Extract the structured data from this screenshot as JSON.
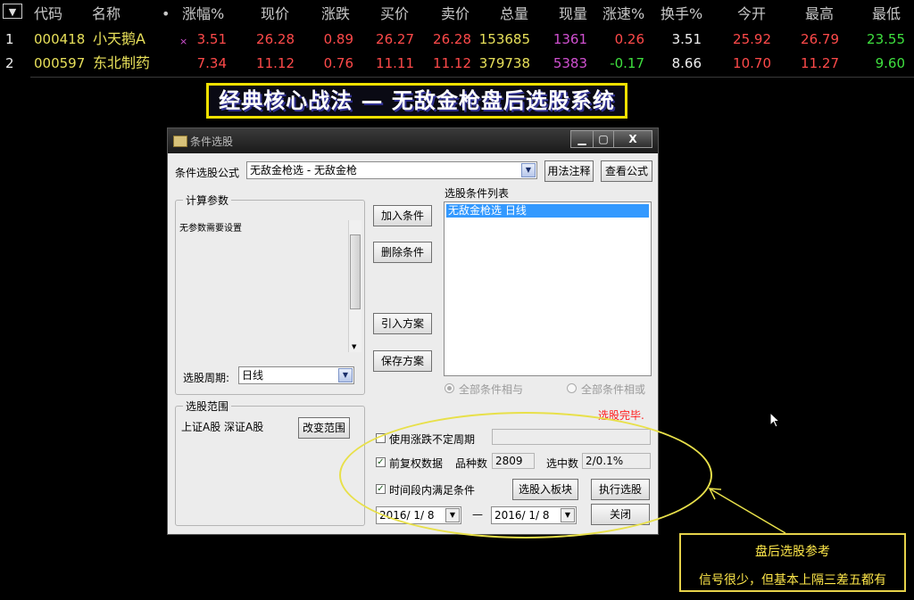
{
  "quote_table": {
    "sort_button": "▼",
    "headers": [
      "代码",
      "名称",
      "•",
      "涨幅%",
      "现价",
      "涨跌",
      "买价",
      "卖价",
      "总量",
      "现量",
      "涨速%",
      "换手%",
      "今开",
      "最高",
      "最低"
    ],
    "rows": [
      {
        "index": "1",
        "code": "000418",
        "name": "小天鹅A",
        "mark": "×",
        "change_pct": "3.51",
        "price": "26.28",
        "change": "0.89",
        "bid": "26.27",
        "ask": "26.28",
        "volume": "153685",
        "cur_vol": "1361",
        "speed": "0.26",
        "turnover": "3.51",
        "open": "25.92",
        "high": "26.79",
        "low": "23.55"
      },
      {
        "index": "2",
        "code": "000597",
        "name": "东北制药",
        "mark": "",
        "change_pct": "7.34",
        "price": "11.12",
        "change": "0.76",
        "bid": "11.11",
        "ask": "11.12",
        "volume": "379738",
        "cur_vol": "5383",
        "speed": "-0.17",
        "turnover": "8.66",
        "open": "10.70",
        "high": "11.27",
        "low": "9.60"
      }
    ]
  },
  "banner": {
    "text": "经典核心战法 — 无敌金枪盘后选股系统"
  },
  "dialog": {
    "title": "条件选股",
    "formula_label": "条件选股公式",
    "formula_value": "无敌金枪选   - 无敌金枪",
    "usage_button": "用法注释",
    "view_formula_button": "查看公式",
    "params_group": "计算参数",
    "params_text": "无参数需要设置",
    "period_label": "选股周期:",
    "period_value": "日线",
    "add_condition": "加入条件",
    "delete_condition": "删除条件",
    "import_plan": "引入方案",
    "save_plan": "保存方案",
    "conditions_list_label": "选股条件列表",
    "conditions": [
      "无敌金枪选   日线"
    ],
    "radio_and": "全部条件相与",
    "radio_or": "全部条件相或",
    "status": "选股完毕.",
    "range_group": "选股范围",
    "range_value": "上证A股 深证A股",
    "change_range": "改变范围",
    "use_var_period": "使用涨跌不定周期",
    "forward_adjust": "前复权数据",
    "variety_label": "品种数",
    "variety_value": "2809",
    "selected_label": "选中数",
    "selected_value": "2/0.1%",
    "time_condition": "时间段内满足条件",
    "select_to_block": "选股入板块",
    "execute": "执行选股",
    "date_from": "2016/ 1/ 8",
    "date_sep": "—",
    "date_to": "2016/ 1/ 8",
    "close": "关闭"
  },
  "callout": {
    "title": "盘后选股参考",
    "text": "信号很少，但基本上隔三差五都有"
  },
  "colors": {
    "up": "#ff4a4a",
    "down": "#3fe03f",
    "code": "#e8e05a",
    "annotation": "#e8e04a",
    "selection": "#3399ff"
  }
}
